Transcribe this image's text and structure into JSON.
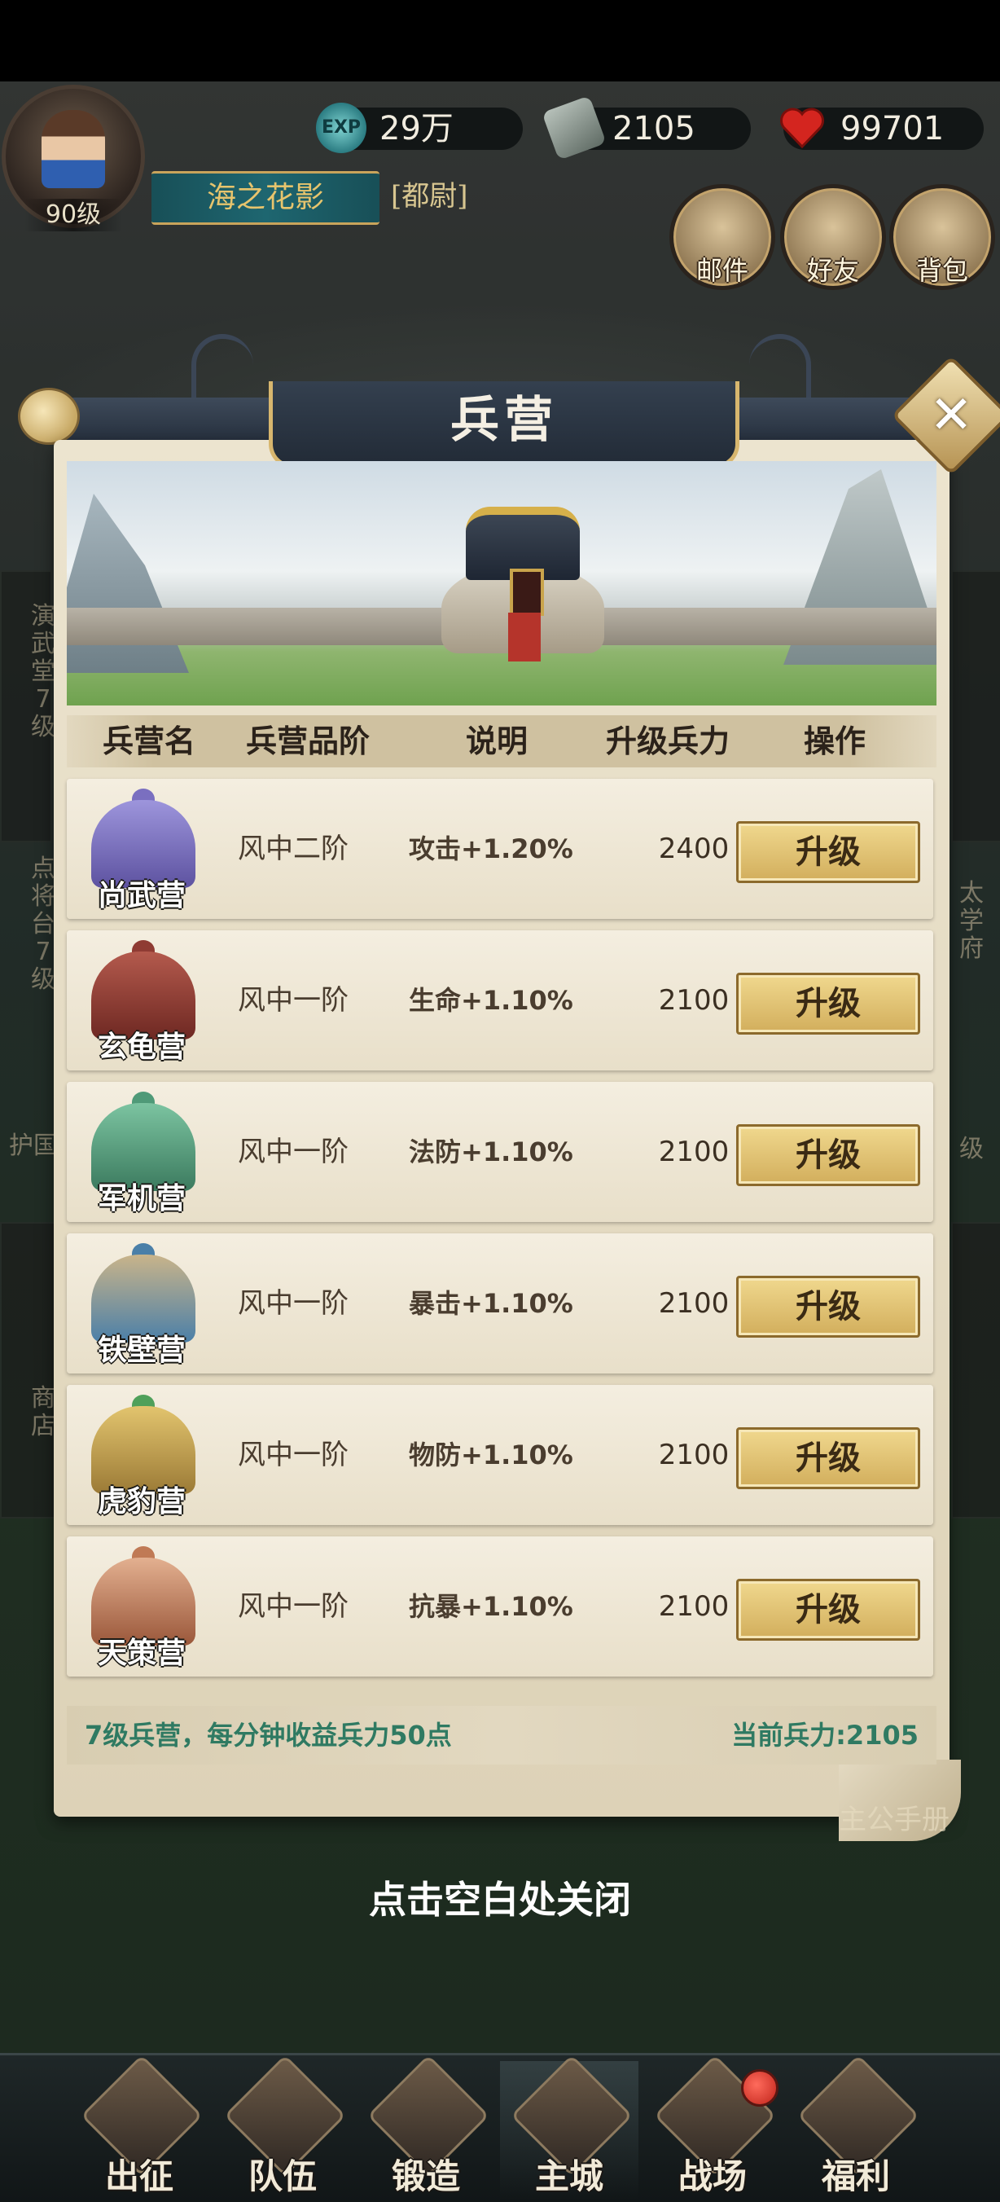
{
  "hud": {
    "level": "90级",
    "player_name": "海之花影",
    "rank_title": "[都尉]",
    "exp_value": "29万",
    "exp_icon_text": "EXP",
    "token_value": "2105",
    "hearts_value": "99701",
    "buttons": [
      {
        "label": "邮件",
        "icon": "mail-icon"
      },
      {
        "label": "好友",
        "icon": "friends-icon"
      },
      {
        "label": "背包",
        "icon": "bag-icon"
      }
    ]
  },
  "background": {
    "left_labels": [
      "演武堂7级",
      "点将台7级",
      "护国",
      "商店"
    ],
    "right_labels": [
      "太学府",
      "级"
    ],
    "manual_label": "主公手册"
  },
  "dialog": {
    "title": "兵营",
    "close_icon": "close-icon",
    "headers": [
      "兵营名",
      "兵营品阶",
      "说明",
      "升级兵力",
      "操作"
    ],
    "rows": [
      {
        "name": "尚武营",
        "grade": "风中二阶",
        "desc": "攻击+1.20%",
        "cost": "2400",
        "action": "升级",
        "color": "#7a6fc0"
      },
      {
        "name": "玄龟营",
        "grade": "风中一阶",
        "desc": "生命+1.10%",
        "cost": "2100",
        "action": "升级",
        "color": "#8f3b33"
      },
      {
        "name": "军机营",
        "grade": "风中一阶",
        "desc": "法防+1.10%",
        "cost": "2100",
        "action": "升级",
        "color": "#4f9a78"
      },
      {
        "name": "铁壁营",
        "grade": "风中一阶",
        "desc": "暴击+1.10%",
        "cost": "2100",
        "action": "升级",
        "color": "#4a7fa8"
      },
      {
        "name": "虎豹营",
        "grade": "风中一阶",
        "desc": "物防+1.10%",
        "cost": "2100",
        "action": "升级",
        "color": "#c9a14d"
      },
      {
        "name": "天策营",
        "grade": "风中一阶",
        "desc": "抗暴+1.10%",
        "cost": "2100",
        "action": "升级",
        "color": "#c07a55"
      }
    ],
    "footer_left": "7级兵营，每分钟收益兵力50点",
    "footer_right": "当前兵力:2105"
  },
  "hint": "点击空白处关闭",
  "nav": [
    {
      "label": "出征",
      "icon": "campaign-icon"
    },
    {
      "label": "队伍",
      "icon": "team-icon"
    },
    {
      "label": "锻造",
      "icon": "forge-icon"
    },
    {
      "label": "主城",
      "icon": "city-icon",
      "active": true
    },
    {
      "label": "战场",
      "icon": "battlefield-icon",
      "badge": true
    },
    {
      "label": "福利",
      "icon": "welfare-icon"
    }
  ]
}
